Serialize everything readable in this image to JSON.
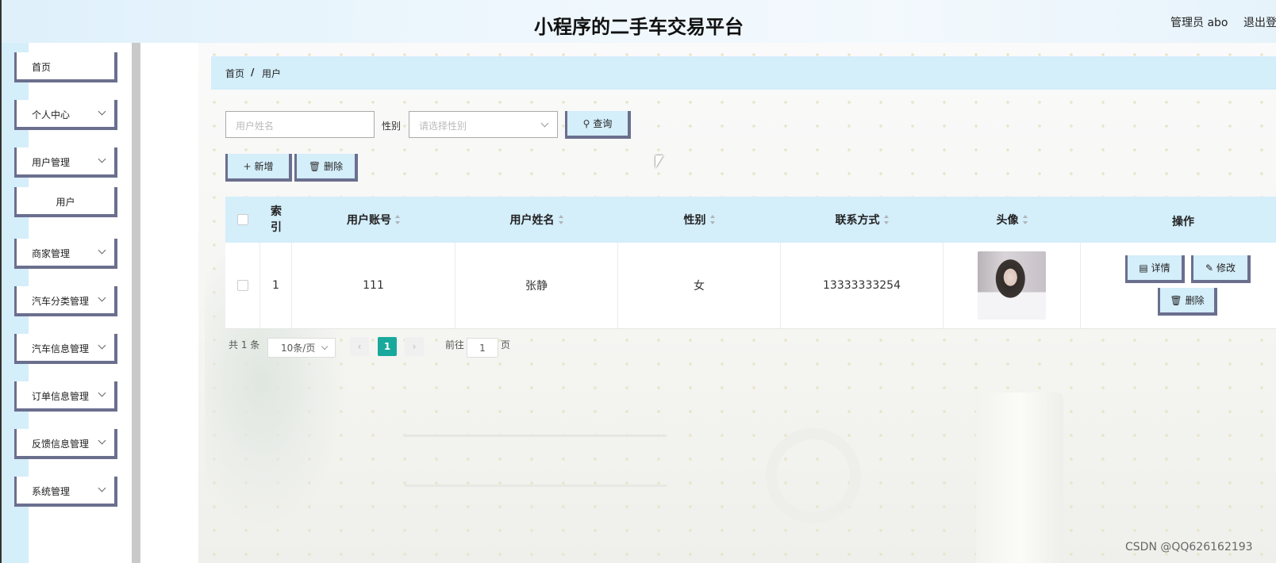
{
  "header": {
    "title": "小程序的二手车交易平台",
    "admin": "管理员 abo",
    "logout": "退出登"
  },
  "sidebar": {
    "items": [
      {
        "label": "首页"
      },
      {
        "label": "个人中心"
      },
      {
        "label": "用户管理"
      },
      {
        "label": "用户"
      },
      {
        "label": "商家管理"
      },
      {
        "label": "汽车分类管理"
      },
      {
        "label": "汽车信息管理"
      },
      {
        "label": "订单信息管理"
      },
      {
        "label": "反馈信息管理"
      },
      {
        "label": "系统管理"
      }
    ]
  },
  "breadcrumb": {
    "home": "首页",
    "sep": "/",
    "current": "用户"
  },
  "search": {
    "name_placeholder": "用户姓名",
    "gender_label": "性别",
    "gender_placeholder": "请选择性别",
    "query_label": "查询"
  },
  "toolbar": {
    "add_label": "新增",
    "delete_label": "删除"
  },
  "table": {
    "headers": {
      "index": "索引",
      "account": "用户账号",
      "name": "用户姓名",
      "gender": "性别",
      "contact": "联系方式",
      "avatar": "头像",
      "actions": "操作"
    },
    "rows": [
      {
        "index": "1",
        "account": "111",
        "name": "张静",
        "gender": "女",
        "contact": "13333333254"
      }
    ],
    "actions": {
      "detail": "详情",
      "edit": "修改",
      "delete": "删除"
    }
  },
  "pagination": {
    "total": "共 1 条",
    "page_size": "10条/页",
    "current_page": "1",
    "goto_label": "前往",
    "goto_value": "1",
    "page_suffix": "页"
  },
  "watermark": "CSDN @QQ626162193",
  "colors": {
    "accent_light": "#d4eefa",
    "button_border": "#6b6f8e",
    "pager_active": "#18a99c"
  }
}
